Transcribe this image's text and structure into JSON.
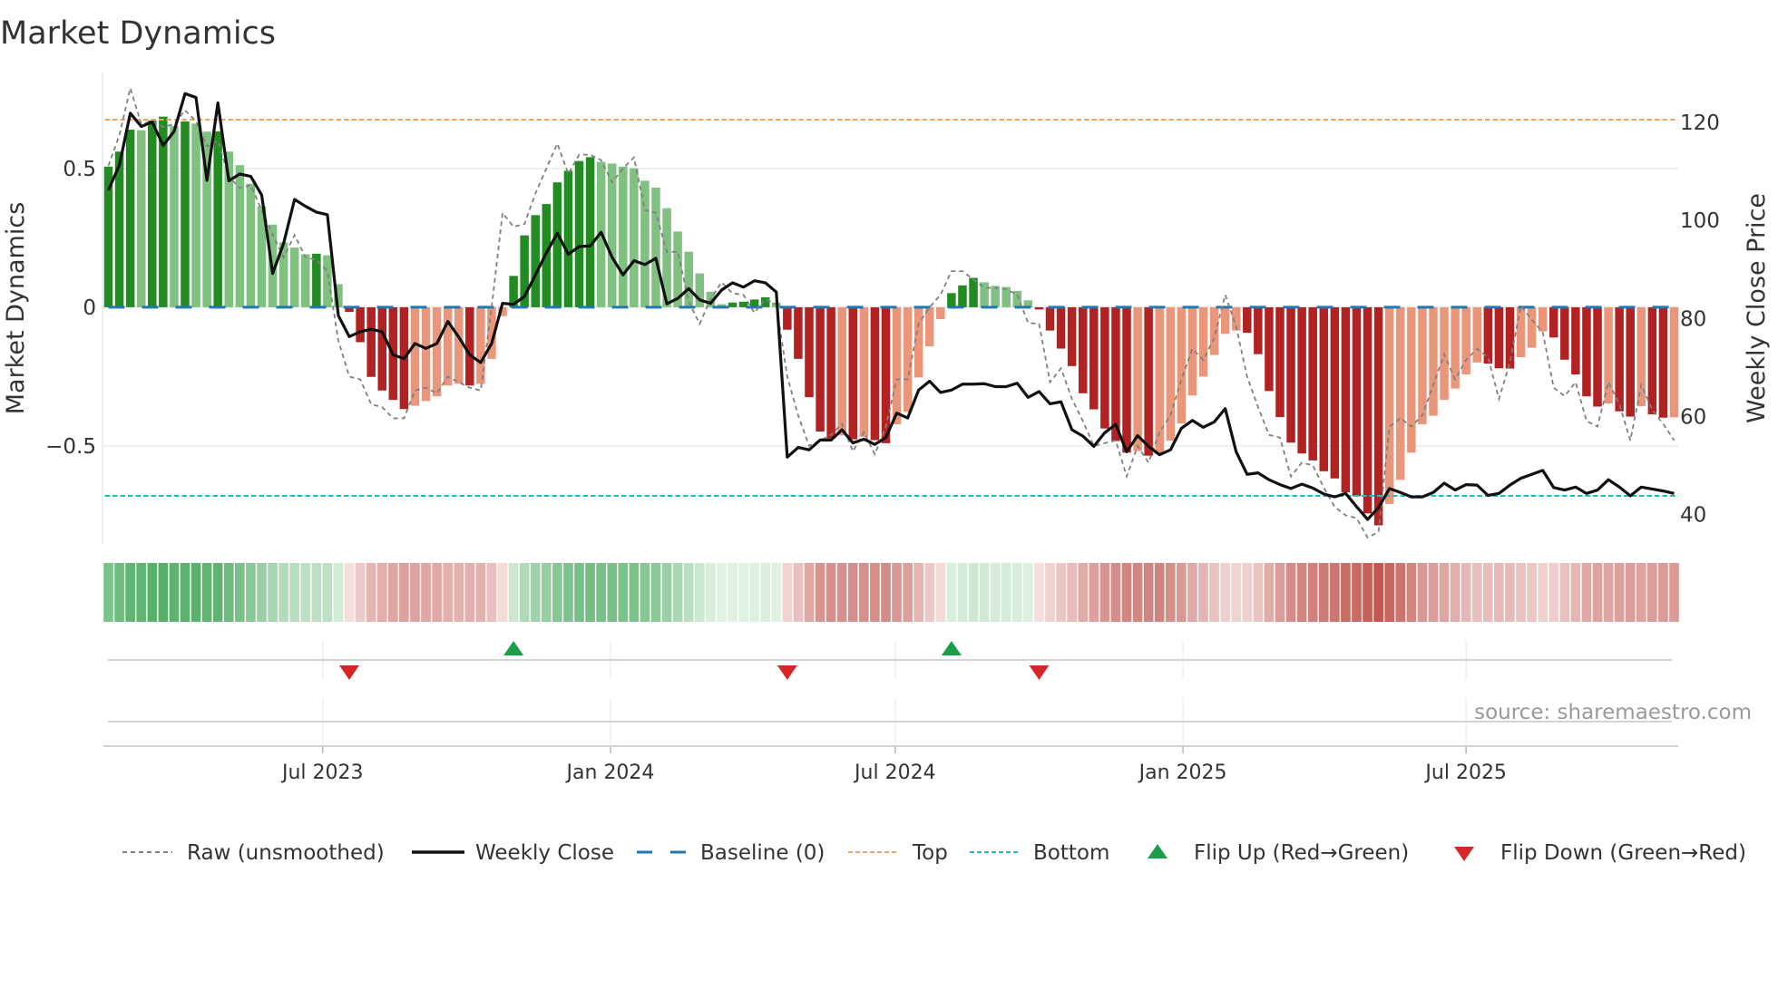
{
  "title": "Market Dynamics",
  "source": "source: sharemaestro.com",
  "legend": {
    "raw": "Raw (unsmoothed)",
    "close": "Weekly Close",
    "baseline": "Baseline (0)",
    "top": "Top",
    "bottom": "Bottom",
    "flip_up": "Flip Up (Red→Green)",
    "flip_down": "Flip Down (Green→Red)"
  },
  "chart_data": {
    "type": "bar",
    "title": "Market Dynamics",
    "ylabel": "Market Dynamics",
    "ylabel_right": "Weekly Close Price",
    "xlabel": "",
    "x_start_week": "2023-02-14",
    "x_interval_days": 7,
    "ylim": [
      -0.853,
      0.846
    ],
    "ylim_right": [
      34.0,
      130.2
    ],
    "grid": true,
    "legend_position": "bottom",
    "yticks": [
      {
        "v": 0.5,
        "label": "0.5"
      },
      {
        "v": 0,
        "label": "0"
      },
      {
        "v": -0.5,
        "label": "−0.5"
      }
    ],
    "yticks_right": [
      {
        "v": 120,
        "label": "120"
      },
      {
        "v": 100,
        "label": "100"
      },
      {
        "v": 80,
        "label": "80"
      },
      {
        "v": 60,
        "label": "60"
      },
      {
        "v": 40,
        "label": "40"
      }
    ],
    "xticks": [
      {
        "date": "2023-07-01",
        "label": "Jul 2023"
      },
      {
        "date": "2024-01-01",
        "label": "Jan 2024"
      },
      {
        "date": "2024-07-01",
        "label": "Jul 2024"
      },
      {
        "date": "2025-01-01",
        "label": "Jan 2025"
      },
      {
        "date": "2025-07-01",
        "label": "Jul 2025"
      }
    ],
    "top_level": 0.676,
    "bottom_level": -0.68,
    "baseline": 0,
    "series": [
      {
        "name": "Market Dynamics (smoothed)",
        "kind": "bar",
        "values": [
          0.507,
          0.561,
          0.64,
          0.638,
          0.673,
          0.687,
          0.653,
          0.67,
          0.662,
          0.633,
          0.634,
          0.561,
          0.512,
          0.445,
          0.364,
          0.298,
          0.234,
          0.215,
          0.191,
          0.193,
          0.187,
          0.083,
          -0.017,
          -0.126,
          -0.251,
          -0.3,
          -0.334,
          -0.367,
          -0.355,
          -0.338,
          -0.321,
          -0.282,
          -0.276,
          -0.282,
          -0.276,
          -0.186,
          -0.032,
          0.113,
          0.259,
          0.332,
          0.372,
          0.45,
          0.492,
          0.527,
          0.541,
          0.524,
          0.518,
          0.507,
          0.501,
          0.456,
          0.431,
          0.357,
          0.273,
          0.2,
          0.122,
          0.056,
          0.011,
          0.017,
          0.02,
          0.028,
          0.036,
          0.017,
          -0.081,
          -0.186,
          -0.324,
          -0.448,
          -0.473,
          -0.462,
          -0.476,
          -0.467,
          -0.479,
          -0.49,
          -0.422,
          -0.377,
          -0.253,
          -0.141,
          -0.043,
          0.051,
          0.079,
          0.106,
          0.09,
          0.077,
          0.073,
          0.059,
          0.025,
          -0.008,
          -0.084,
          -0.149,
          -0.212,
          -0.31,
          -0.368,
          -0.437,
          -0.482,
          -0.524,
          -0.518,
          -0.535,
          -0.529,
          -0.481,
          -0.419,
          -0.318,
          -0.25,
          -0.172,
          -0.096,
          -0.084,
          -0.092,
          -0.169,
          -0.302,
          -0.396,
          -0.488,
          -0.527,
          -0.552,
          -0.591,
          -0.617,
          -0.667,
          -0.681,
          -0.743,
          -0.786,
          -0.709,
          -0.622,
          -0.524,
          -0.422,
          -0.391,
          -0.334,
          -0.293,
          -0.242,
          -0.199,
          -0.203,
          -0.22,
          -0.221,
          -0.18,
          -0.146,
          -0.087,
          -0.109,
          -0.189,
          -0.242,
          -0.321,
          -0.358,
          -0.347,
          -0.375,
          -0.394,
          -0.357,
          -0.386,
          -0.398,
          -0.397
        ]
      },
      {
        "name": "Raw (unsmoothed)",
        "kind": "line",
        "values": [
          0.51,
          0.62,
          0.79,
          0.66,
          0.67,
          0.65,
          0.66,
          0.71,
          0.67,
          0.58,
          0.6,
          0.47,
          0.43,
          0.44,
          0.35,
          0.26,
          0.18,
          0.26,
          0.18,
          0.17,
          0.13,
          -0.12,
          -0.25,
          -0.26,
          -0.35,
          -0.36,
          -0.4,
          -0.4,
          -0.3,
          -0.29,
          -0.31,
          -0.25,
          -0.27,
          -0.29,
          -0.3,
          0.0,
          0.34,
          0.29,
          0.3,
          0.41,
          0.5,
          0.59,
          0.48,
          0.55,
          0.55,
          0.53,
          0.45,
          0.5,
          0.54,
          0.35,
          0.34,
          0.2,
          0.2,
          0.02,
          -0.06,
          0.03,
          0.09,
          0.05,
          0.045,
          -0.02,
          0.03,
          0.01,
          -0.25,
          -0.39,
          -0.5,
          -0.48,
          -0.46,
          -0.42,
          -0.52,
          -0.45,
          -0.53,
          -0.43,
          -0.26,
          -0.26,
          -0.06,
          0.0,
          0.045,
          0.13,
          0.13,
          0.1,
          0.07,
          0.07,
          0.065,
          0.045,
          -0.056,
          -0.06,
          -0.27,
          -0.22,
          -0.33,
          -0.41,
          -0.5,
          -0.49,
          -0.48,
          -0.61,
          -0.5,
          -0.56,
          -0.45,
          -0.39,
          -0.26,
          -0.15,
          -0.19,
          -0.11,
          0.045,
          -0.07,
          -0.25,
          -0.36,
          -0.46,
          -0.47,
          -0.61,
          -0.56,
          -0.57,
          -0.65,
          -0.72,
          -0.75,
          -0.76,
          -0.83,
          -0.81,
          -0.43,
          -0.4,
          -0.43,
          -0.39,
          -0.28,
          -0.17,
          -0.26,
          -0.19,
          -0.15,
          -0.18,
          -0.33,
          -0.2,
          0.005,
          -0.045,
          -0.09,
          -0.29,
          -0.32,
          -0.27,
          -0.41,
          -0.43,
          -0.27,
          -0.35,
          -0.48,
          -0.28,
          -0.37,
          -0.42,
          -0.48
        ]
      },
      {
        "name": "Weekly Close",
        "kind": "line",
        "axis": "right",
        "values": [
          106.2,
          111.3,
          121.9,
          119.2,
          120.1,
          115.3,
          118.2,
          125.9,
          125.1,
          108.2,
          124,
          108.1,
          109.5,
          109,
          105.2,
          89.2,
          95.3,
          104.3,
          102.9,
          101.7,
          101.2,
          80.6,
          76.3,
          77.3,
          77.8,
          77.3,
          72.6,
          71.8,
          74.9,
          73.9,
          74.9,
          79.4,
          76.2,
          72.6,
          71,
          74.9,
          83.1,
          82.9,
          84.5,
          88.9,
          93.4,
          97.4,
          93.1,
          94.7,
          94.8,
          97.6,
          92.5,
          88.9,
          91.8,
          91,
          92.3,
          83,
          84.1,
          86.1,
          83.8,
          83.1,
          85.8,
          87.3,
          86.4,
          87.7,
          87.3,
          85.4,
          51.7,
          53.7,
          53.2,
          55.2,
          55.2,
          57.3,
          54.6,
          55.4,
          54.3,
          55.7,
          60.7,
          59.7,
          65.4,
          67.2,
          64.9,
          65.4,
          66.6,
          66.6,
          66.7,
          66.1,
          66.1,
          66.8,
          63.9,
          65.1,
          62.6,
          63.0,
          57.3,
          56,
          53.9,
          56.7,
          58.4,
          52.8,
          56.1,
          53.9,
          52.2,
          53.2,
          57.6,
          59.2,
          57.8,
          58.9,
          61.6,
          52.8,
          48.2,
          48.5,
          47.1,
          46.1,
          45.3,
          46.2,
          45.4,
          44.2,
          43.6,
          44.3,
          41.6,
          39.0,
          41.4,
          45.3,
          44.5,
          43.6,
          43.6,
          44.5,
          46.4,
          45.0,
          46.1,
          46.0,
          43.9,
          44.3,
          46.0,
          47.4,
          48.2,
          49.0,
          45.5,
          45.0,
          45.6,
          44.3,
          45.0,
          47.1,
          45.6,
          43.8,
          45.6,
          45.2,
          44.8,
          44.3
        ]
      }
    ],
    "flips_up_weeks": [
      38,
      78
    ],
    "flips_down_weeks": [
      23,
      63,
      86
    ],
    "colors": {
      "pos_strong": "#228b22",
      "pos_weak": "#80c080",
      "neg_strong": "#b22222",
      "neg_weak": "#e9967a",
      "raw": "#808080",
      "close": "#111111",
      "baseline": "#1f77b4",
      "top": "#f4a460",
      "bottom": "#17becf",
      "flip_up": "#1a9e47",
      "flip_down": "#d62728"
    }
  }
}
